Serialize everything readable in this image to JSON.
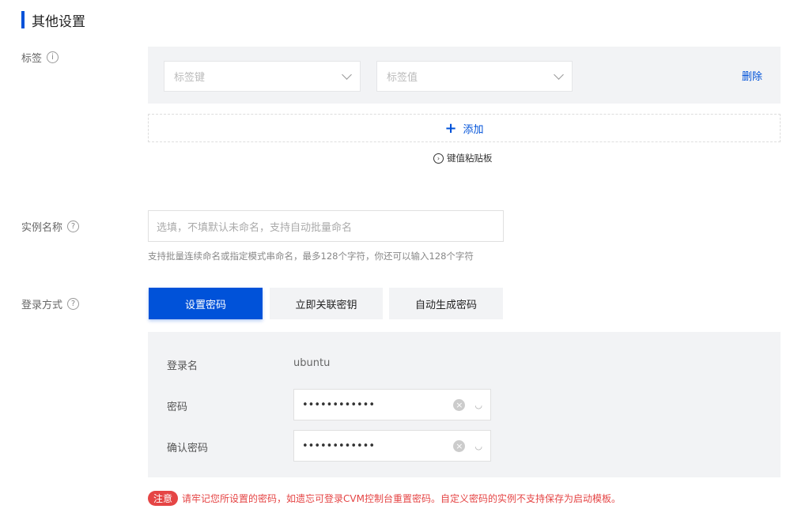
{
  "section_title": "其他设置",
  "tags": {
    "label": "标签",
    "key_placeholder": "标签键",
    "value_placeholder": "标签值",
    "delete": "删除",
    "add": "添加",
    "paste": "键值粘贴板"
  },
  "instance_name": {
    "label": "实例名称",
    "placeholder": "选填，不填默认未命名，支持自动批量命名",
    "hint": "支持批量连续命名或指定模式串命名，最多128个字符，你还可以输入128个字符"
  },
  "login": {
    "label": "登录方式",
    "options": [
      "设置密码",
      "立即关联密钥",
      "自动生成密码"
    ],
    "username_label": "登录名",
    "username": "ubuntu",
    "password_label": "密码",
    "password": "••••••••••••",
    "confirm_label": "确认密码",
    "confirm": "••••••••••••"
  },
  "note": {
    "badge": "注意",
    "text": "请牢记您所设置的密码，如遗忘可登录CVM控制台重置密码。自定义密码的实例不支持保存为启动模板。"
  }
}
